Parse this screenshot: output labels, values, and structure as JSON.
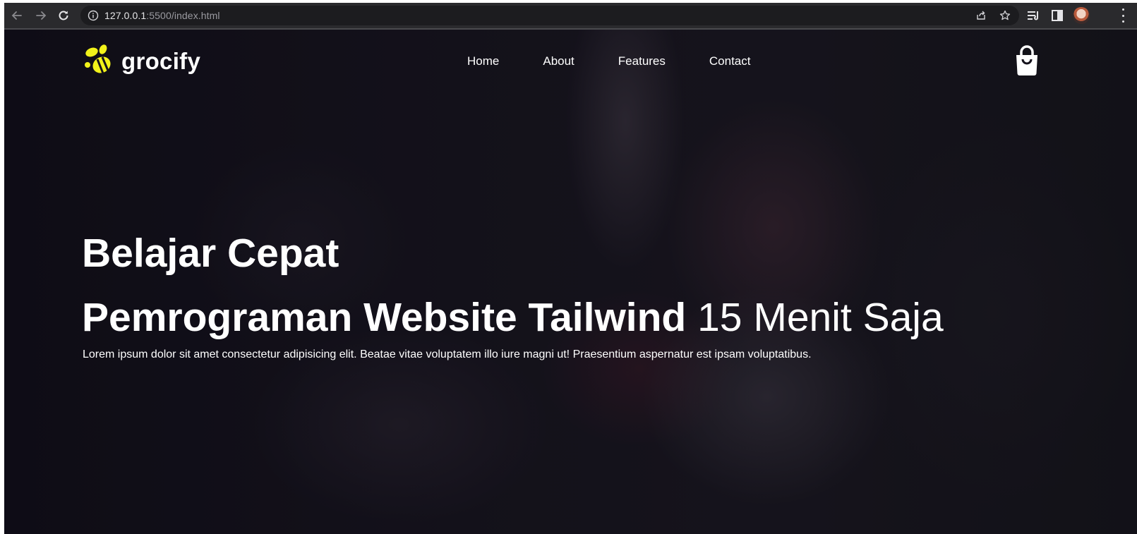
{
  "browser": {
    "url_host": "127.0.0.1",
    "url_rest": ":5500/index.html"
  },
  "site": {
    "logo_text": "grocify",
    "brand_color": "#f2f21a",
    "nav": [
      "Home",
      "About",
      "Features",
      "Contact"
    ],
    "cart_icon": "shopping-bag-icon"
  },
  "hero": {
    "title_line1": "Belajar Cepat",
    "title_line2_bold": "Pemrograman Website Tailwind",
    "title_line2_light": "15 Menit Saja",
    "description": "Lorem ipsum dolor sit amet consectetur adipisicing elit. Beatae vitae voluptatem illo iure magni ut! Praesentium aspernatur est ipsam voluptatibus."
  }
}
